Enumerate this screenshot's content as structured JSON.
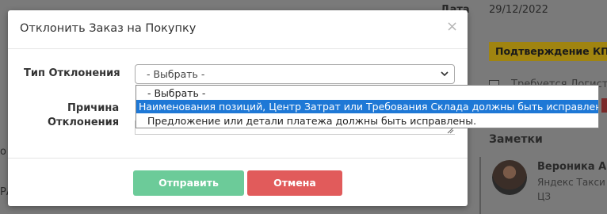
{
  "background": {
    "date_label": "Дата",
    "date_value": "29/12/2022",
    "badge": "Подтверждение КП",
    "checkbox_text": "Требуется Логистика",
    "notes_heading": "Заметки",
    "note_author": "Вероника Ана",
    "note_text_1": "Яндекс Такси -",
    "note_text_2": "ЦЗ",
    "left_edge_1": "о",
    "left_edge_2": "РА"
  },
  "modal": {
    "title": "Отклонить Заказ на Покупку",
    "close": "×",
    "reason_type_label": "Тип Отклонения",
    "reason_label_line1": "Причина",
    "reason_label_line2": "Отклонения",
    "select_value": "- Выбрать -",
    "submit_label": "Отправить",
    "cancel_label": "Отмена",
    "colors": {
      "submit": "#6ccb99",
      "cancel": "#e15b5b",
      "highlight": "#1e78d6",
      "badge": "#a08410"
    }
  },
  "dropdown": {
    "options": [
      "- Выбрать -",
      "Наименования позиций, Центр Затрат или Требования Склада должны быть исправлены",
      "Предложение или детали платежа должны быть исправлены."
    ],
    "selected_index": 1
  }
}
